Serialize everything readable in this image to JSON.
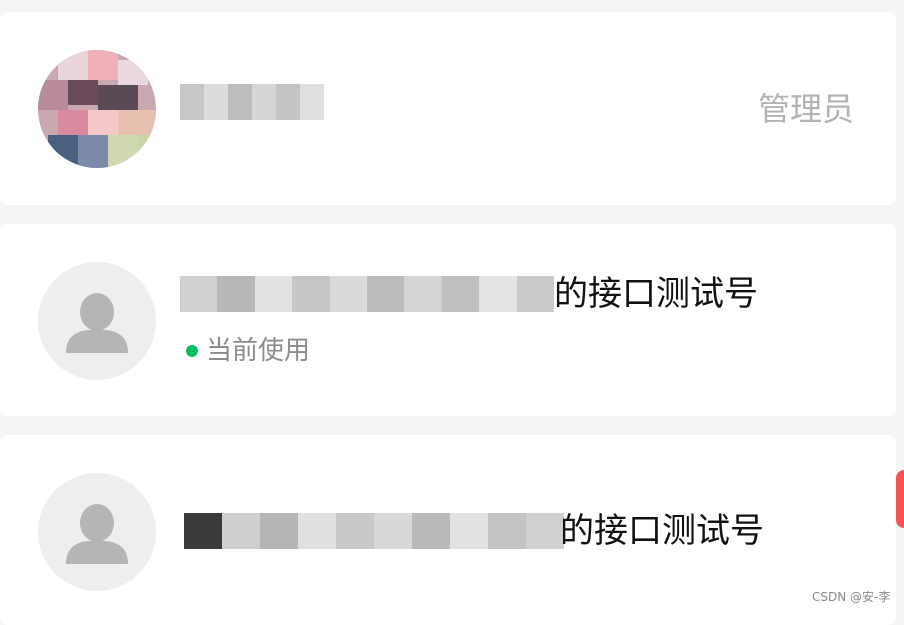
{
  "accounts": [
    {
      "role_label": "管理员"
    },
    {
      "name_suffix": "的接口测试号",
      "status_label": "当前使用",
      "status_color": "#07c160"
    },
    {
      "name_suffix": "的接口测试号"
    }
  ],
  "watermark": "CSDN @安-李",
  "icons": {
    "default_avatar": "person-silhouette-icon"
  }
}
